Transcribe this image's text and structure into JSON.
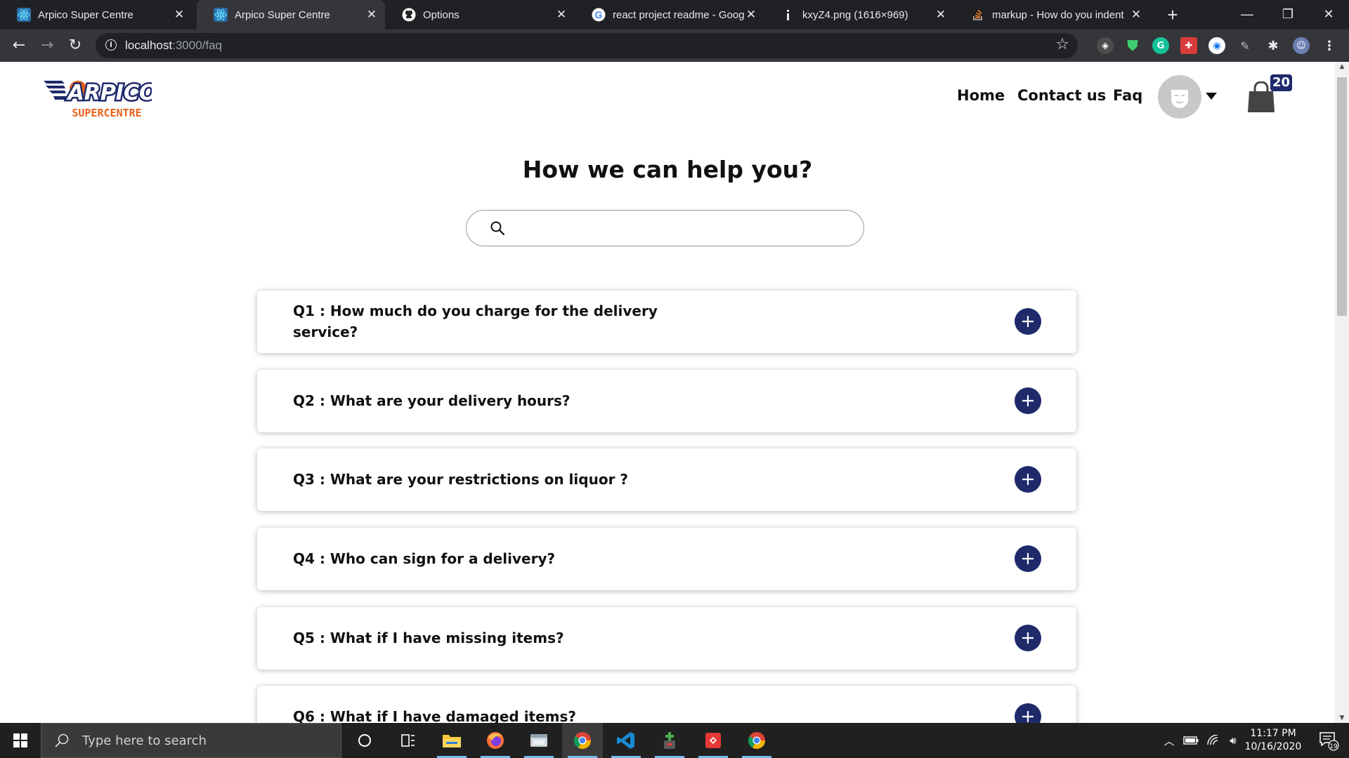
{
  "browser": {
    "tabs": [
      {
        "title": "Arpico Super Centre",
        "icon": "react-icon",
        "active": false
      },
      {
        "title": "Arpico Super Centre",
        "icon": "react-icon",
        "active": true
      },
      {
        "title": "Options",
        "icon": "github-icon",
        "active": false
      },
      {
        "title": "react project readme - Goog",
        "icon": "google-icon",
        "active": false
      },
      {
        "title": "kxyZ4.png (1616×969)",
        "icon": "image-icon",
        "active": false
      },
      {
        "title": "markup - How do you indent",
        "icon": "stackoverflow-icon",
        "active": false
      }
    ],
    "url_host": "localhost",
    "url_path": ":3000/faq"
  },
  "site": {
    "logo_text": "ARPICO",
    "logo_sub": "SUPERCENTRE",
    "nav": {
      "home": "Home",
      "contact": "Contact us",
      "faq": "Faq"
    },
    "cart_count": "20",
    "brand_color": "#1f2a6b"
  },
  "faq_page": {
    "heading": "How we can help you?",
    "search_placeholder": "",
    "questions": [
      "Q1 : How much do you charge for the delivery service?",
      "Q2 : What are your delivery hours?",
      "Q3 : What are your restrictions on liquor ?",
      "Q4 : Who can sign for a delivery?",
      "Q5 : What if I have missing items?",
      "Q6 : What if I have damaged items?"
    ]
  },
  "taskbar": {
    "search_text": "Type here to search",
    "time": "11:17 PM",
    "date": "10/16/2020",
    "notifications": "19"
  }
}
